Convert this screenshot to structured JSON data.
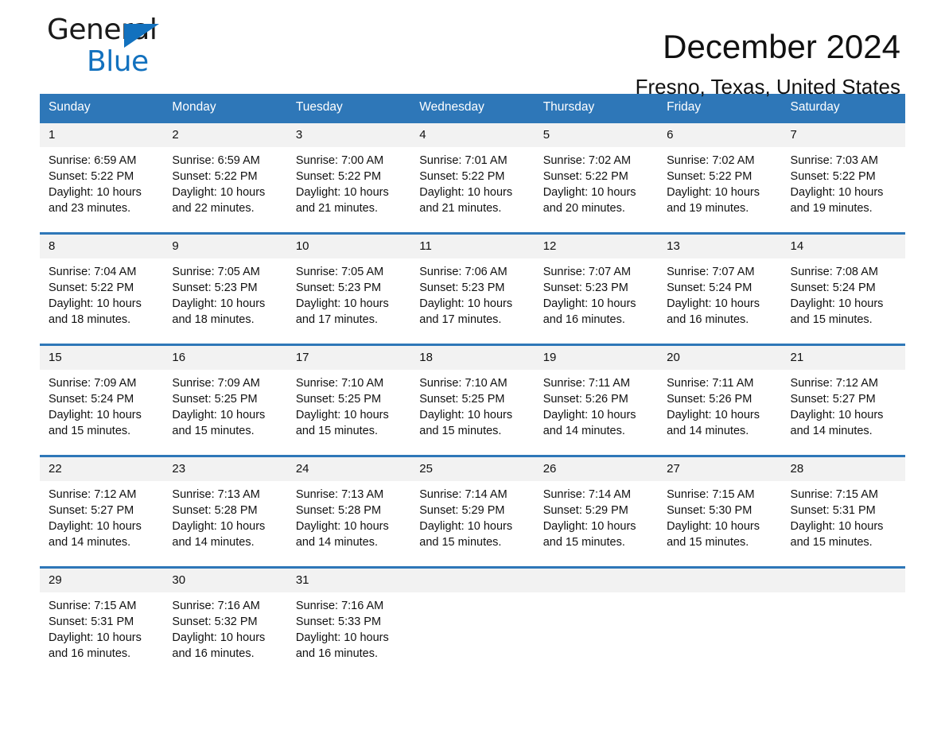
{
  "brand": {
    "name_part1": "General",
    "name_part2": "Blue",
    "triangle_color": "#1271BE"
  },
  "header": {
    "title": "December 2024",
    "subtitle": "Fresno, Texas, United States",
    "accent_color": "#2E77B8",
    "daynum_bg": "#F2F2F2"
  },
  "weekdays": [
    "Sunday",
    "Monday",
    "Tuesday",
    "Wednesday",
    "Thursday",
    "Friday",
    "Saturday"
  ],
  "labels": {
    "sunrise_prefix": "Sunrise:",
    "sunset_prefix": "Sunset:",
    "daylight_prefix": "Daylight:"
  },
  "weeks": [
    [
      {
        "day": "1",
        "sunrise": "Sunrise: 6:59 AM",
        "sunset": "Sunset: 5:22 PM",
        "daylight_1": "Daylight: 10 hours",
        "daylight_2": "and 23 minutes."
      },
      {
        "day": "2",
        "sunrise": "Sunrise: 6:59 AM",
        "sunset": "Sunset: 5:22 PM",
        "daylight_1": "Daylight: 10 hours",
        "daylight_2": "and 22 minutes."
      },
      {
        "day": "3",
        "sunrise": "Sunrise: 7:00 AM",
        "sunset": "Sunset: 5:22 PM",
        "daylight_1": "Daylight: 10 hours",
        "daylight_2": "and 21 minutes."
      },
      {
        "day": "4",
        "sunrise": "Sunrise: 7:01 AM",
        "sunset": "Sunset: 5:22 PM",
        "daylight_1": "Daylight: 10 hours",
        "daylight_2": "and 21 minutes."
      },
      {
        "day": "5",
        "sunrise": "Sunrise: 7:02 AM",
        "sunset": "Sunset: 5:22 PM",
        "daylight_1": "Daylight: 10 hours",
        "daylight_2": "and 20 minutes."
      },
      {
        "day": "6",
        "sunrise": "Sunrise: 7:02 AM",
        "sunset": "Sunset: 5:22 PM",
        "daylight_1": "Daylight: 10 hours",
        "daylight_2": "and 19 minutes."
      },
      {
        "day": "7",
        "sunrise": "Sunrise: 7:03 AM",
        "sunset": "Sunset: 5:22 PM",
        "daylight_1": "Daylight: 10 hours",
        "daylight_2": "and 19 minutes."
      }
    ],
    [
      {
        "day": "8",
        "sunrise": "Sunrise: 7:04 AM",
        "sunset": "Sunset: 5:22 PM",
        "daylight_1": "Daylight: 10 hours",
        "daylight_2": "and 18 minutes."
      },
      {
        "day": "9",
        "sunrise": "Sunrise: 7:05 AM",
        "sunset": "Sunset: 5:23 PM",
        "daylight_1": "Daylight: 10 hours",
        "daylight_2": "and 18 minutes."
      },
      {
        "day": "10",
        "sunrise": "Sunrise: 7:05 AM",
        "sunset": "Sunset: 5:23 PM",
        "daylight_1": "Daylight: 10 hours",
        "daylight_2": "and 17 minutes."
      },
      {
        "day": "11",
        "sunrise": "Sunrise: 7:06 AM",
        "sunset": "Sunset: 5:23 PM",
        "daylight_1": "Daylight: 10 hours",
        "daylight_2": "and 17 minutes."
      },
      {
        "day": "12",
        "sunrise": "Sunrise: 7:07 AM",
        "sunset": "Sunset: 5:23 PM",
        "daylight_1": "Daylight: 10 hours",
        "daylight_2": "and 16 minutes."
      },
      {
        "day": "13",
        "sunrise": "Sunrise: 7:07 AM",
        "sunset": "Sunset: 5:24 PM",
        "daylight_1": "Daylight: 10 hours",
        "daylight_2": "and 16 minutes."
      },
      {
        "day": "14",
        "sunrise": "Sunrise: 7:08 AM",
        "sunset": "Sunset: 5:24 PM",
        "daylight_1": "Daylight: 10 hours",
        "daylight_2": "and 15 minutes."
      }
    ],
    [
      {
        "day": "15",
        "sunrise": "Sunrise: 7:09 AM",
        "sunset": "Sunset: 5:24 PM",
        "daylight_1": "Daylight: 10 hours",
        "daylight_2": "and 15 minutes."
      },
      {
        "day": "16",
        "sunrise": "Sunrise: 7:09 AM",
        "sunset": "Sunset: 5:25 PM",
        "daylight_1": "Daylight: 10 hours",
        "daylight_2": "and 15 minutes."
      },
      {
        "day": "17",
        "sunrise": "Sunrise: 7:10 AM",
        "sunset": "Sunset: 5:25 PM",
        "daylight_1": "Daylight: 10 hours",
        "daylight_2": "and 15 minutes."
      },
      {
        "day": "18",
        "sunrise": "Sunrise: 7:10 AM",
        "sunset": "Sunset: 5:25 PM",
        "daylight_1": "Daylight: 10 hours",
        "daylight_2": "and 15 minutes."
      },
      {
        "day": "19",
        "sunrise": "Sunrise: 7:11 AM",
        "sunset": "Sunset: 5:26 PM",
        "daylight_1": "Daylight: 10 hours",
        "daylight_2": "and 14 minutes."
      },
      {
        "day": "20",
        "sunrise": "Sunrise: 7:11 AM",
        "sunset": "Sunset: 5:26 PM",
        "daylight_1": "Daylight: 10 hours",
        "daylight_2": "and 14 minutes."
      },
      {
        "day": "21",
        "sunrise": "Sunrise: 7:12 AM",
        "sunset": "Sunset: 5:27 PM",
        "daylight_1": "Daylight: 10 hours",
        "daylight_2": "and 14 minutes."
      }
    ],
    [
      {
        "day": "22",
        "sunrise": "Sunrise: 7:12 AM",
        "sunset": "Sunset: 5:27 PM",
        "daylight_1": "Daylight: 10 hours",
        "daylight_2": "and 14 minutes."
      },
      {
        "day": "23",
        "sunrise": "Sunrise: 7:13 AM",
        "sunset": "Sunset: 5:28 PM",
        "daylight_1": "Daylight: 10 hours",
        "daylight_2": "and 14 minutes."
      },
      {
        "day": "24",
        "sunrise": "Sunrise: 7:13 AM",
        "sunset": "Sunset: 5:28 PM",
        "daylight_1": "Daylight: 10 hours",
        "daylight_2": "and 14 minutes."
      },
      {
        "day": "25",
        "sunrise": "Sunrise: 7:14 AM",
        "sunset": "Sunset: 5:29 PM",
        "daylight_1": "Daylight: 10 hours",
        "daylight_2": "and 15 minutes."
      },
      {
        "day": "26",
        "sunrise": "Sunrise: 7:14 AM",
        "sunset": "Sunset: 5:29 PM",
        "daylight_1": "Daylight: 10 hours",
        "daylight_2": "and 15 minutes."
      },
      {
        "day": "27",
        "sunrise": "Sunrise: 7:15 AM",
        "sunset": "Sunset: 5:30 PM",
        "daylight_1": "Daylight: 10 hours",
        "daylight_2": "and 15 minutes."
      },
      {
        "day": "28",
        "sunrise": "Sunrise: 7:15 AM",
        "sunset": "Sunset: 5:31 PM",
        "daylight_1": "Daylight: 10 hours",
        "daylight_2": "and 15 minutes."
      }
    ],
    [
      {
        "day": "29",
        "sunrise": "Sunrise: 7:15 AM",
        "sunset": "Sunset: 5:31 PM",
        "daylight_1": "Daylight: 10 hours",
        "daylight_2": "and 16 minutes."
      },
      {
        "day": "30",
        "sunrise": "Sunrise: 7:16 AM",
        "sunset": "Sunset: 5:32 PM",
        "daylight_1": "Daylight: 10 hours",
        "daylight_2": "and 16 minutes."
      },
      {
        "day": "31",
        "sunrise": "Sunrise: 7:16 AM",
        "sunset": "Sunset: 5:33 PM",
        "daylight_1": "Daylight: 10 hours",
        "daylight_2": "and 16 minutes."
      },
      {
        "day": "",
        "sunrise": "",
        "sunset": "",
        "daylight_1": "",
        "daylight_2": ""
      },
      {
        "day": "",
        "sunrise": "",
        "sunset": "",
        "daylight_1": "",
        "daylight_2": ""
      },
      {
        "day": "",
        "sunrise": "",
        "sunset": "",
        "daylight_1": "",
        "daylight_2": ""
      },
      {
        "day": "",
        "sunrise": "",
        "sunset": "",
        "daylight_1": "",
        "daylight_2": ""
      }
    ]
  ]
}
